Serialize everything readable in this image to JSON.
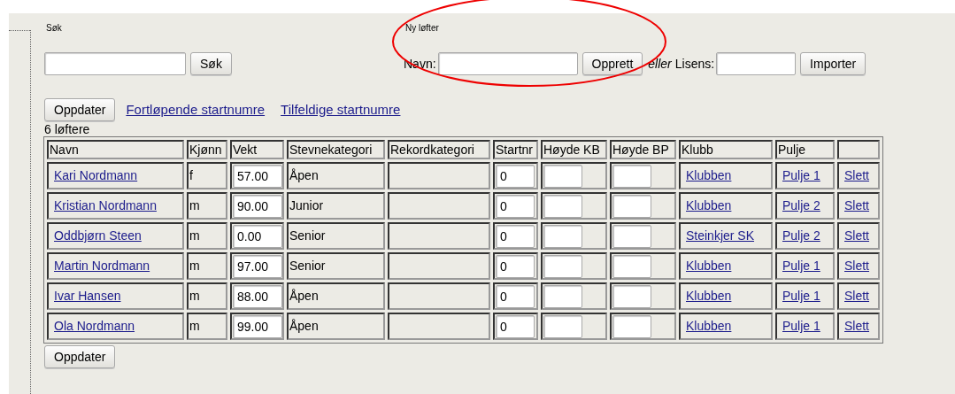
{
  "search": {
    "heading": "Søk",
    "button": "Søk"
  },
  "new_lifter": {
    "heading": "Ny løfter",
    "name_label": "Navn:",
    "create_button": "Opprett",
    "or_text": "eller",
    "license_label": "Lisens:",
    "import_button": "Importer"
  },
  "actions": {
    "update_button": "Oppdater",
    "links": [
      "Fortløpende startnumre",
      "Tilfeldige startnumre"
    ]
  },
  "count": "6 løftere",
  "table": {
    "columns": [
      "Navn",
      "Kjønn",
      "Vekt",
      "Stevnekategori",
      "Rekordkategori",
      "Startnr",
      "Høyde KB",
      "Høyde BP",
      "Klubb",
      "Pulje"
    ],
    "rows": [
      {
        "name": "Kari Nordmann",
        "gender": "f",
        "weight": "57.00",
        "category": "Åpen",
        "start_no": "0",
        "club": "Klubben",
        "pool": "Pulje 1",
        "delete": "Slett"
      },
      {
        "name": "Kristian Nordmann",
        "gender": "m",
        "weight": "90.00",
        "category": "Junior",
        "start_no": "0",
        "club": "Klubben",
        "pool": "Pulje 2",
        "delete": "Slett"
      },
      {
        "name": "Oddbjørn Steen",
        "gender": "m",
        "weight": "0.00",
        "category": "Senior",
        "start_no": "0",
        "club": "Steinkjer SK",
        "pool": "Pulje 2",
        "delete": "Slett"
      },
      {
        "name": "Martin Nordmann",
        "gender": "m",
        "weight": "97.00",
        "category": "Senior",
        "start_no": "0",
        "club": "Klubben",
        "pool": "Pulje 1",
        "delete": "Slett"
      },
      {
        "name": "Ivar Hansen",
        "gender": "m",
        "weight": "88.00",
        "category": "Åpen",
        "start_no": "0",
        "club": "Klubben",
        "pool": "Pulje 1",
        "delete": "Slett"
      },
      {
        "name": "Ola Nordmann",
        "gender": "m",
        "weight": "99.00",
        "category": "Åpen",
        "start_no": "0",
        "club": "Klubben",
        "pool": "Pulje 1",
        "delete": "Slett"
      }
    ]
  },
  "bottom_button": "Oppdater",
  "annotations": [
    {
      "kind": "ellipse",
      "color": "#ee0000"
    }
  ]
}
